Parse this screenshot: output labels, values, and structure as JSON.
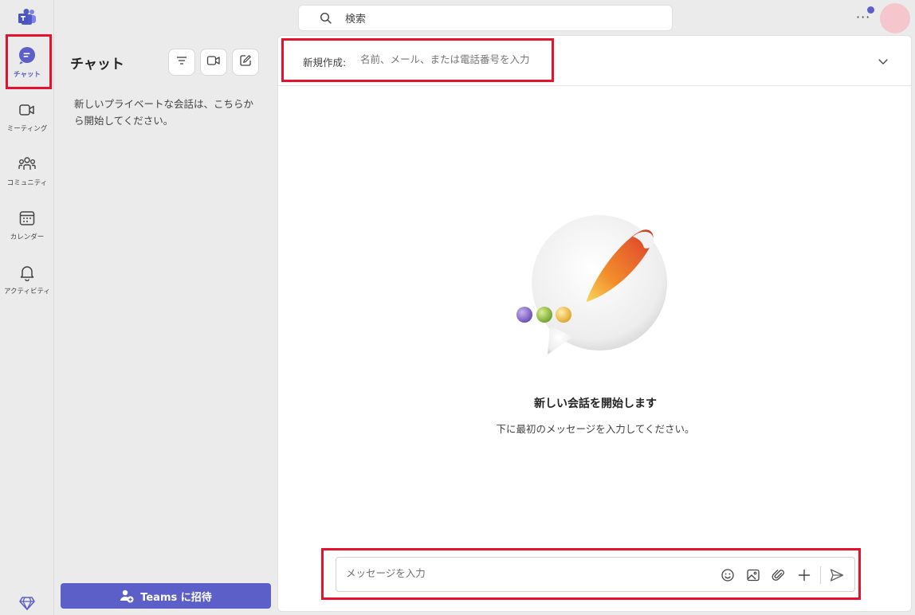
{
  "rail": {
    "items": [
      {
        "label": "チャット",
        "icon": "chat-icon",
        "active": true
      },
      {
        "label": "ミーティング",
        "icon": "video-icon"
      },
      {
        "label": "コミュニティ",
        "icon": "people-icon"
      },
      {
        "label": "カレンダー",
        "icon": "calendar-icon"
      },
      {
        "label": "アクティビティ",
        "icon": "bell-icon"
      }
    ]
  },
  "search": {
    "placeholder": "検索"
  },
  "panel": {
    "title": "チャット",
    "hint": "新しいプライベートな会話は、こちらから開始してください。",
    "invite_label": "Teams に招待"
  },
  "main": {
    "to_label": "新規作成:",
    "to_placeholder": "名前、メール、または電話番号を入力",
    "empty_title": "新しい会話を開始します",
    "empty_subtitle": "下に最初のメッセージを入力してください。",
    "composer_placeholder": "メッセージを入力"
  },
  "colors": {
    "accent": "#5b5fc7",
    "highlight": "#e8112d"
  }
}
